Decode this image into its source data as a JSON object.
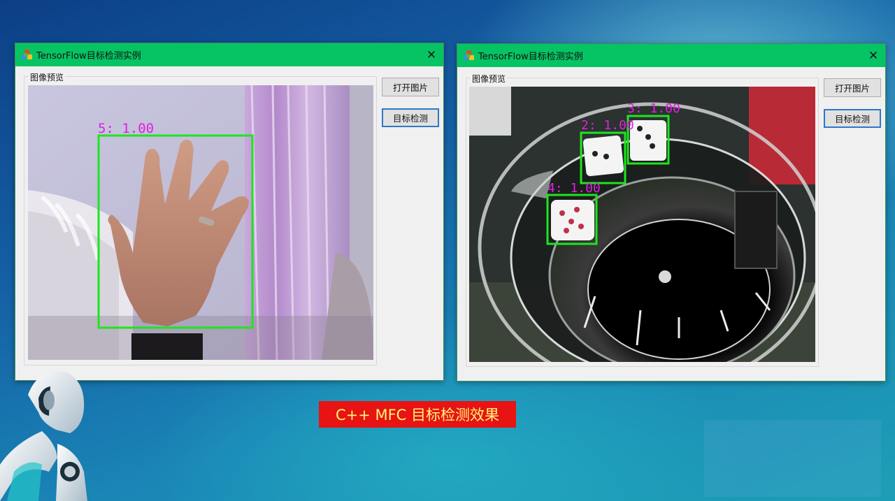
{
  "windows": [
    {
      "title": "TensorFlow目标检测实例",
      "group_label": "图像预览",
      "buttons": {
        "open": "打开图片",
        "detect": "目标检测"
      },
      "detections": [
        {
          "label": "5: 1.00"
        }
      ]
    },
    {
      "title": "TensorFlow目标检测实例",
      "group_label": "图像预览",
      "buttons": {
        "open": "打开图片",
        "detect": "目标检测"
      },
      "detections": [
        {
          "label": "2: 1.00"
        },
        {
          "label": "3: 1.00"
        },
        {
          "label": "4: 1.00"
        }
      ]
    }
  ],
  "caption": "C++ MFC 目标检测效果",
  "colors": {
    "title_bar": "#06c463",
    "box": "#1ee51e",
    "box_label": "#e020e0",
    "caption_bg": "#e81313",
    "caption_text": "#fff67a"
  },
  "icons": [
    "app-icon",
    "close-icon"
  ]
}
